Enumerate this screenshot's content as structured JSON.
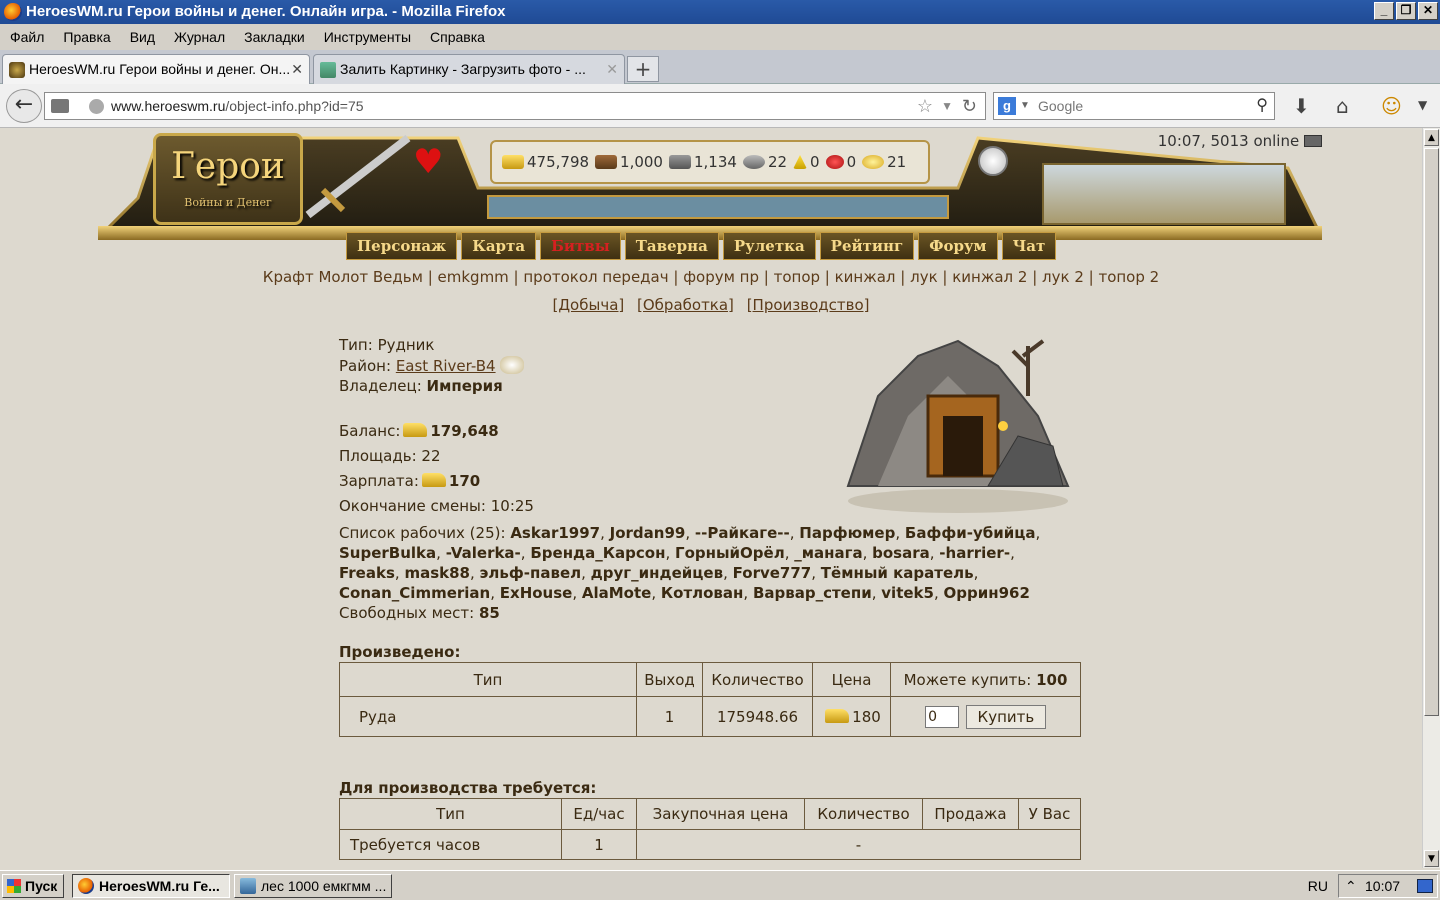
{
  "window": {
    "title": "HeroesWM.ru Герои войны и денег. Онлайн игра. - Mozilla Firefox"
  },
  "menu": [
    "Файл",
    "Правка",
    "Вид",
    "Журнал",
    "Закладки",
    "Инструменты",
    "Справка"
  ],
  "tabs": [
    {
      "label": "HeroesWM.ru Герои войны и денег. Он..."
    },
    {
      "label": "Залить Картинку - Загрузить фото - ..."
    }
  ],
  "nav": {
    "url_host": "www.heroeswm.ru",
    "url_path": "/object-info.php?id=75",
    "search_placeholder": "Google"
  },
  "header": {
    "status": "10:07, 5013 online",
    "resources": [
      {
        "name": "gold",
        "value": "475,798",
        "color": "#e0b83a"
      },
      {
        "name": "wood",
        "value": "1,000",
        "color": "#8a5a2a"
      },
      {
        "name": "ore",
        "value": "1,134",
        "color": "#777777"
      },
      {
        "name": "mercury",
        "value": "22",
        "color": "#999999"
      },
      {
        "name": "sulfur",
        "value": "0",
        "color": "#e0b000"
      },
      {
        "name": "crystals",
        "value": "0",
        "color": "#cc2233"
      },
      {
        "name": "gems",
        "value": "21",
        "color": "#f0c040"
      }
    ],
    "logo_title": "Герои",
    "logo_subtitle": "Войны и Денег",
    "menu": [
      {
        "label": "Персонаж",
        "highlight": false
      },
      {
        "label": "Карта",
        "highlight": false
      },
      {
        "label": "Битвы",
        "highlight": true
      },
      {
        "label": "Таверна",
        "highlight": false
      },
      {
        "label": "Рулетка",
        "highlight": false
      },
      {
        "label": "Рейтинг",
        "highlight": false
      },
      {
        "label": "Форум",
        "highlight": false
      },
      {
        "label": "Чат",
        "highlight": false
      }
    ]
  },
  "quicklinks": "Крафт Молот Ведьм | emkgmm | протокол передач | форум пр | топор | кинжал | лук | кинжал 2 | лук 2 | топор 2",
  "sublinks": [
    "[Добыча]",
    "[Обработка]",
    "[Производство]"
  ],
  "object": {
    "type_label": "Тип:",
    "type_value": "Рудник",
    "region_label": "Район:",
    "region_value": "East River-B4",
    "owner_label": "Владелец:",
    "owner_value": "Империя",
    "balance_label": "Баланс:",
    "balance_value": "179,648",
    "area_label": "Площадь:",
    "area_value": "22",
    "salary_label": "Зарплата:",
    "salary_value": "170",
    "shift_label": "Окончание смены:",
    "shift_value": "10:25",
    "workers_label": "Список рабочих (25):",
    "workers": [
      "Askar1997",
      "Jordan99",
      "--Райкаге--",
      "Парфюмер",
      "Баффи-убийца",
      "SuperBulka",
      "-Valerka-",
      "Бренда_Карсон",
      "ГорныйОрёл",
      "_манага",
      "bosara",
      "-harrier-",
      "Freaks",
      "mask88",
      "эльф-павел",
      "друг_индейцев",
      "Forve777",
      "Тёмный каратель",
      "Conan_Cimmerian",
      "ExHouse",
      "AlaMote",
      "Котлован",
      "Варвар_степи",
      "vitek5",
      "Оррин962"
    ],
    "free_label": "Свободных мест:",
    "free_value": "85"
  },
  "produced": {
    "title": "Произведено:",
    "headers": [
      "Тип",
      "Выход",
      "Количество",
      "Цена",
      "Можете купить:"
    ],
    "can_buy": "100",
    "row": {
      "type": "Руда",
      "output": "1",
      "quantity": "175948.66",
      "price": "180",
      "input_value": "0",
      "buy_label": "Купить"
    }
  },
  "required": {
    "title": "Для производства требуется:",
    "headers": [
      "Тип",
      "Ед/час",
      "Закупочная цена",
      "Количество",
      "Продажа",
      "У Вас"
    ],
    "row": {
      "type": "Требуется часов",
      "per_hour": "1",
      "rest": "-"
    }
  },
  "taskbar": {
    "start": "Пуск",
    "items": [
      "HeroesWM.ru Ге...",
      "лес 1000 емкгмм ..."
    ],
    "lang": "RU",
    "clock": "10:07"
  }
}
